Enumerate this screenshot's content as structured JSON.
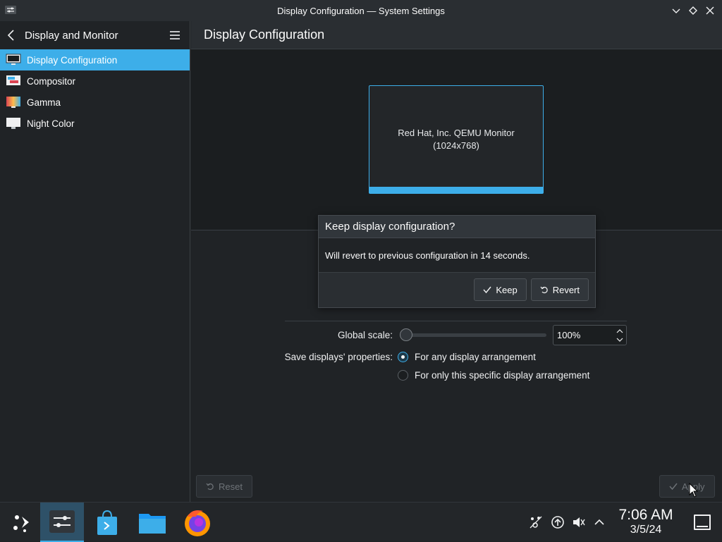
{
  "window": {
    "title": "Display Configuration — System Settings"
  },
  "sidebar": {
    "header_title": "Display and Monitor",
    "items": [
      {
        "label": "Display Configuration",
        "icon": "monitor-icon",
        "active": true
      },
      {
        "label": "Compositor",
        "icon": "compositor-icon",
        "active": false
      },
      {
        "label": "Gamma",
        "icon": "gamma-icon",
        "active": false
      },
      {
        "label": "Night Color",
        "icon": "night-color-icon",
        "active": false
      }
    ]
  },
  "main": {
    "page_title": "Display Configuration",
    "monitor": {
      "name": "Red Hat, Inc. QEMU Monitor",
      "resolution": "(1024x768)"
    },
    "dialog": {
      "title": "Keep display configuration?",
      "message": "Will revert to previous configuration in 14 seconds.",
      "keep_label": "Keep",
      "revert_label": "Revert"
    },
    "global_scale": {
      "label": "Global scale:",
      "value": "100%",
      "slider_position": 0
    },
    "save_properties": {
      "label": "Save displays' properties:",
      "options": [
        {
          "label": "For any display arrangement",
          "checked": true
        },
        {
          "label": "For only this specific display arrangement",
          "checked": false
        }
      ]
    },
    "footer": {
      "reset_label": "Reset",
      "apply_label": "Apply"
    }
  },
  "taskbar": {
    "clock": {
      "time": "7:06 AM",
      "date": "3/5/24"
    }
  },
  "colors": {
    "accent": "#3daee9",
    "background": "#202326",
    "titlebar": "#2a2e32"
  }
}
